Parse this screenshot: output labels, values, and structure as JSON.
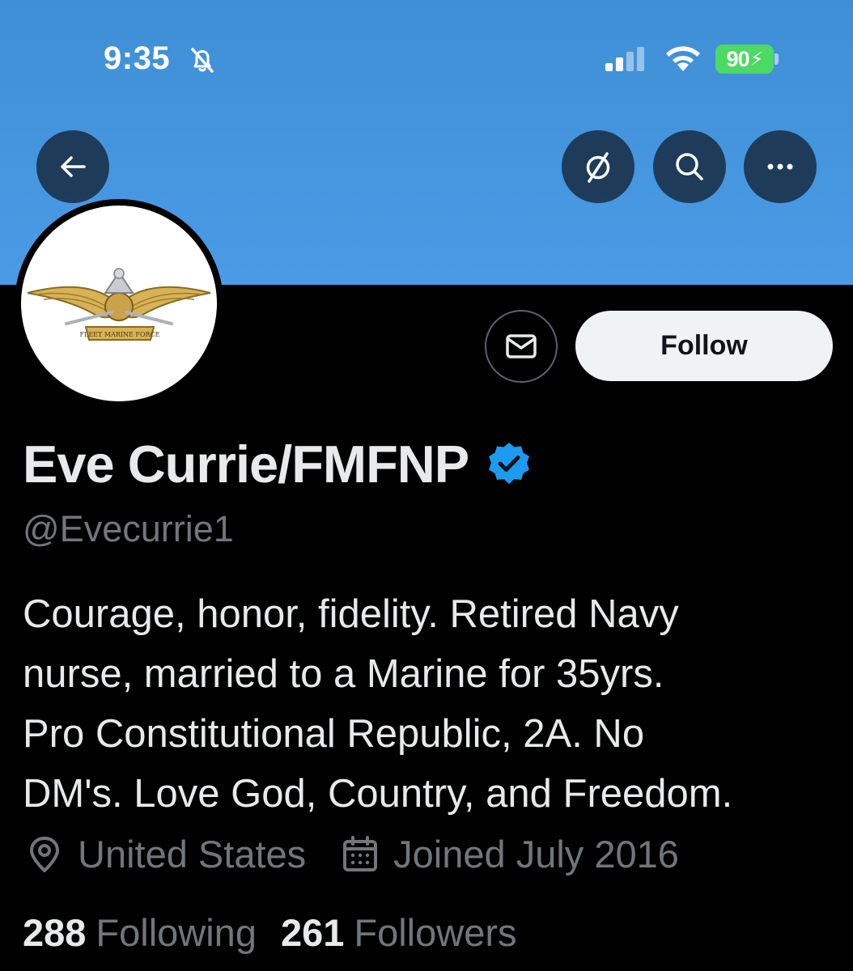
{
  "status_bar": {
    "time": "9:35",
    "battery": "90",
    "icons": [
      "bell-off-icon",
      "signal-icon",
      "wifi-icon",
      "battery-charging-icon"
    ]
  },
  "nav": {
    "icons": [
      "back-arrow-icon",
      "translate-icon",
      "search-icon",
      "more-icon"
    ]
  },
  "profile": {
    "display_name": "Eve Currie/FMFNP",
    "handle": "@Evecurrie1",
    "verified": true,
    "avatar_text": "FLEET MARINE FORCE",
    "bio_lines": [
      "Courage, honor, fidelity. Retired Navy",
      "nurse, married to a Marine for 35yrs.",
      "Pro Constitutional Republic, 2A. No",
      "DM's. Love God, Country, and Freedom."
    ],
    "location": "United States",
    "joined": "Joined July 2016",
    "following_count": "288",
    "following_label": "Following",
    "followers_count": "261",
    "followers_label": "Followers"
  },
  "actions": {
    "follow_label": "Follow",
    "message_icon": "envelope-icon"
  },
  "colors": {
    "banner": "#4a9be6",
    "verified": "#1d9bf0",
    "battery": "#4cd964",
    "muted_text": "#71767b"
  }
}
